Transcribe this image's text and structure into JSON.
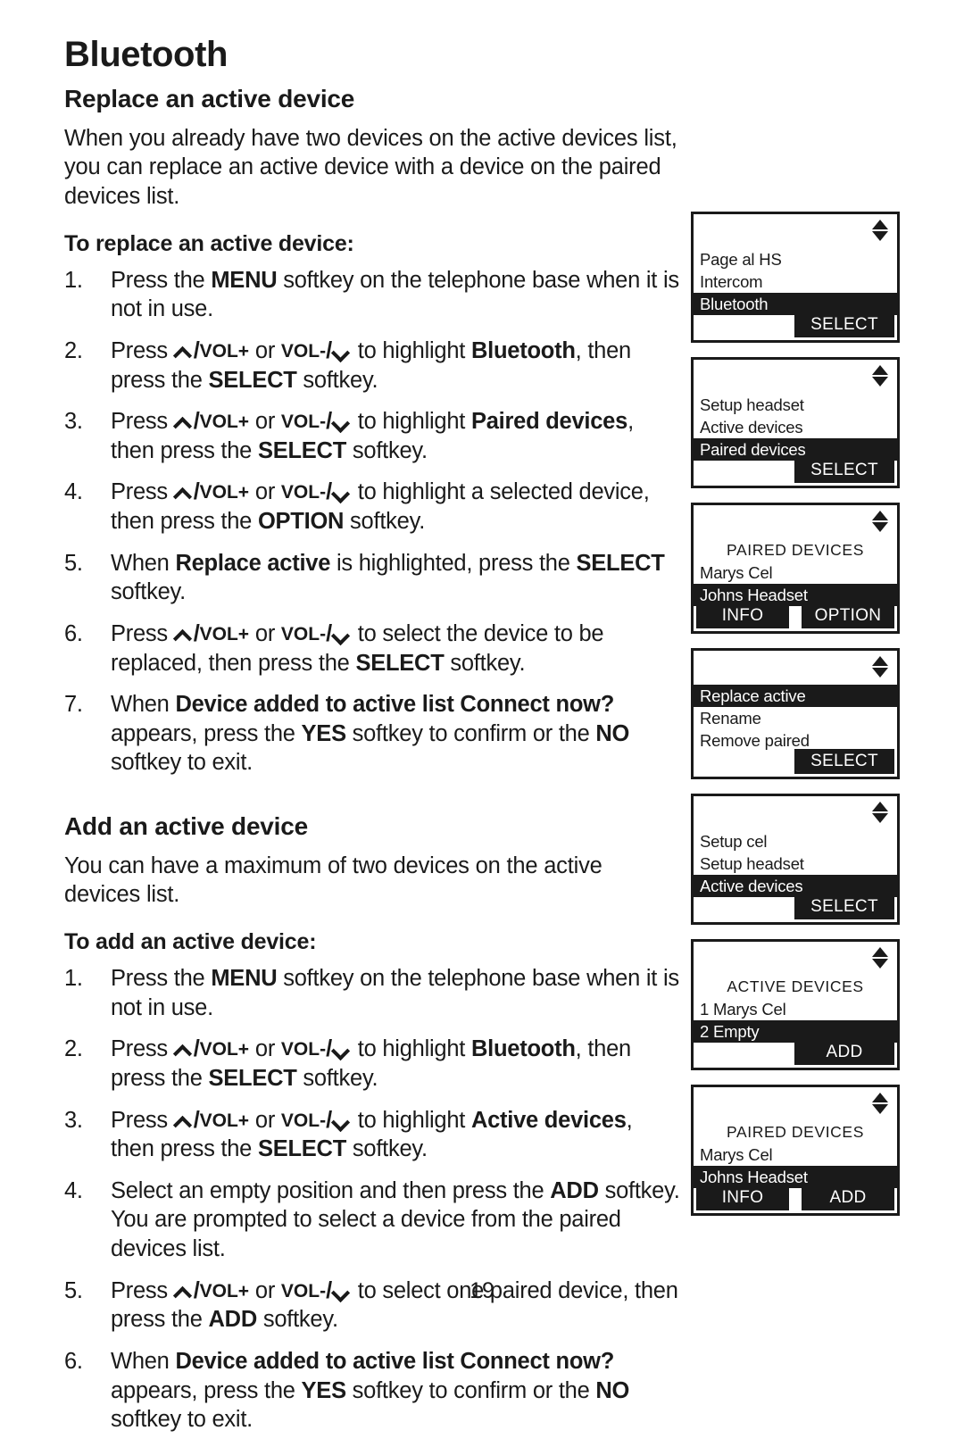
{
  "document": {
    "chapter_title": "Bluetooth",
    "page_number": "19"
  },
  "section_replace": {
    "heading": "Replace an active device",
    "intro": "When you already have two devices on the active devices list, you can replace an active device with a device on the paired devices list.",
    "subhead": "To replace an active device:",
    "steps": [
      {
        "num": "1.",
        "parts": [
          {
            "t": "Press the ",
            "b": false
          },
          {
            "t": "MENU",
            "b": true
          },
          {
            "t": " softkey on the telephone base when it is not in use.",
            "b": false
          }
        ]
      },
      {
        "num": "2.",
        "parts": [
          {
            "t": "Press ",
            "b": false
          },
          {
            "t": "VOLUP",
            "b": false,
            "icon": "vol-up-key"
          },
          {
            "t": " or ",
            "b": false
          },
          {
            "t": "VOLDOWN",
            "b": false,
            "icon": "vol-down-key"
          },
          {
            "t": " to highlight ",
            "b": false
          },
          {
            "t": "Bluetooth",
            "b": true
          },
          {
            "t": ", then press the ",
            "b": false
          },
          {
            "t": "SELECT",
            "b": true
          },
          {
            "t": " softkey.",
            "b": false
          }
        ]
      },
      {
        "num": "3.",
        "parts": [
          {
            "t": "Press ",
            "b": false
          },
          {
            "t": "VOLUP",
            "b": false,
            "icon": "vol-up-key"
          },
          {
            "t": " or ",
            "b": false
          },
          {
            "t": "VOLDOWN",
            "b": false,
            "icon": "vol-down-key"
          },
          {
            "t": " to highlight ",
            "b": false
          },
          {
            "t": "Paired devices",
            "b": true
          },
          {
            "t": ", then press the ",
            "b": false
          },
          {
            "t": "SELECT",
            "b": true
          },
          {
            "t": " softkey.",
            "b": false
          }
        ]
      },
      {
        "num": "4.",
        "parts": [
          {
            "t": "Press ",
            "b": false
          },
          {
            "t": "VOLUP",
            "b": false,
            "icon": "vol-up-key"
          },
          {
            "t": " or ",
            "b": false
          },
          {
            "t": "VOLDOWN",
            "b": false,
            "icon": "vol-down-key"
          },
          {
            "t": " to highlight a selected device, then press the ",
            "b": false
          },
          {
            "t": "OPTION",
            "b": true
          },
          {
            "t": " softkey.",
            "b": false
          }
        ]
      },
      {
        "num": "5.",
        "parts": [
          {
            "t": "When ",
            "b": false
          },
          {
            "t": "Replace active",
            "b": true
          },
          {
            "t": " is highlighted, press the ",
            "b": false
          },
          {
            "t": "SELECT",
            "b": true
          },
          {
            "t": " softkey.",
            "b": false
          }
        ]
      },
      {
        "num": "6.",
        "parts": [
          {
            "t": "Press ",
            "b": false
          },
          {
            "t": "VOLUP",
            "b": false,
            "icon": "vol-up-key"
          },
          {
            "t": " or ",
            "b": false
          },
          {
            "t": "VOLDOWN",
            "b": false,
            "icon": "vol-down-key"
          },
          {
            "t": " to select the device to be replaced, then press the ",
            "b": false
          },
          {
            "t": "SELECT",
            "b": true
          },
          {
            "t": " softkey.",
            "b": false
          }
        ]
      },
      {
        "num": "7.",
        "parts": [
          {
            "t": "When ",
            "b": false
          },
          {
            "t": "Device added to active list Connect now?",
            "b": true
          },
          {
            "t": " appears, press the ",
            "b": false
          },
          {
            "t": "YES",
            "b": true
          },
          {
            "t": " softkey to confirm or the ",
            "b": false
          },
          {
            "t": "NO",
            "b": true
          },
          {
            "t": " softkey to exit.",
            "b": false
          }
        ]
      }
    ]
  },
  "section_add": {
    "heading": "Add an active device",
    "intro": "You can have a maximum of two devices on the active devices list.",
    "subhead": "To add an active device:",
    "steps": [
      {
        "num": "1.",
        "parts": [
          {
            "t": "Press the ",
            "b": false
          },
          {
            "t": "MENU",
            "b": true
          },
          {
            "t": " softkey on the telephone base when it is not in use.",
            "b": false
          }
        ]
      },
      {
        "num": "2.",
        "parts": [
          {
            "t": "Press ",
            "b": false
          },
          {
            "t": "VOLUP",
            "b": false,
            "icon": "vol-up-key"
          },
          {
            "t": " or ",
            "b": false
          },
          {
            "t": "VOLDOWN",
            "b": false,
            "icon": "vol-down-key"
          },
          {
            "t": " to highlight ",
            "b": false
          },
          {
            "t": "Bluetooth",
            "b": true
          },
          {
            "t": ", then press the ",
            "b": false
          },
          {
            "t": "SELECT",
            "b": true
          },
          {
            "t": " softkey.",
            "b": false
          }
        ]
      },
      {
        "num": "3.",
        "parts": [
          {
            "t": "Press ",
            "b": false
          },
          {
            "t": "VOLUP",
            "b": false,
            "icon": "vol-up-key"
          },
          {
            "t": " or ",
            "b": false
          },
          {
            "t": "VOLDOWN",
            "b": false,
            "icon": "vol-down-key"
          },
          {
            "t": " to highlight ",
            "b": false
          },
          {
            "t": "Active devices",
            "b": true
          },
          {
            "t": ", then press the ",
            "b": false
          },
          {
            "t": "SELECT",
            "b": true
          },
          {
            "t": " softkey.",
            "b": false
          }
        ]
      },
      {
        "num": "4.",
        "parts": [
          {
            "t": "Select an empty position and then press the ",
            "b": false
          },
          {
            "t": "ADD",
            "b": true
          },
          {
            "t": " softkey. You are prompted to select a device from the paired devices list.",
            "b": false
          }
        ]
      },
      {
        "num": "5.",
        "parts": [
          {
            "t": "Press ",
            "b": false
          },
          {
            "t": "VOLUP",
            "b": false,
            "icon": "vol-up-key"
          },
          {
            "t": " or ",
            "b": false
          },
          {
            "t": "VOLDOWN",
            "b": false,
            "icon": "vol-down-key"
          },
          {
            "t": " to select one paired device, then press the ",
            "b": false
          },
          {
            "t": "ADD",
            "b": true
          },
          {
            "t": " softkey.",
            "b": false
          }
        ]
      },
      {
        "num": "6.",
        "parts": [
          {
            "t": "When ",
            "b": false
          },
          {
            "t": "Device added to active list Connect now?",
            "b": true
          },
          {
            "t": " appears, press the ",
            "b": false
          },
          {
            "t": "YES",
            "b": true
          },
          {
            "t": " softkey to confirm or the ",
            "b": false
          },
          {
            "t": "NO",
            "b": true
          },
          {
            "t": " softkey to exit.",
            "b": false
          }
        ]
      }
    ]
  },
  "screens": [
    {
      "id": "menu-bluetooth",
      "rows": [
        {
          "text": "Page al HS",
          "highlighted": false,
          "title": false
        },
        {
          "text": "Intercom",
          "highlighted": false,
          "title": false
        },
        {
          "text": "Bluetooth",
          "highlighted": true,
          "title": false
        }
      ],
      "softkeys": [
        "SELECT"
      ]
    },
    {
      "id": "bluetooth-paired-devices",
      "rows": [
        {
          "text": "Setup headset",
          "highlighted": false,
          "title": false
        },
        {
          "text": "Active devices",
          "highlighted": false,
          "title": false
        },
        {
          "text": "Paired devices",
          "highlighted": true,
          "title": false
        }
      ],
      "softkeys": [
        "SELECT"
      ]
    },
    {
      "id": "paired-devices-option",
      "rows": [
        {
          "text": "PAIRED DEVICES",
          "highlighted": false,
          "title": true
        },
        {
          "text": "Marys Cel",
          "highlighted": false,
          "title": false
        },
        {
          "text": "Johns Headset",
          "highlighted": true,
          "title": false
        }
      ],
      "softkeys": [
        "INFO",
        "OPTION"
      ]
    },
    {
      "id": "option-replace-active",
      "rows": [
        {
          "text": "Replace active",
          "highlighted": true,
          "title": false
        },
        {
          "text": "Rename",
          "highlighted": false,
          "title": false
        },
        {
          "text": "Remove paired",
          "highlighted": false,
          "title": false
        }
      ],
      "softkeys": [
        "SELECT"
      ]
    },
    {
      "id": "bluetooth-active-devices",
      "rows": [
        {
          "text": "Setup cel",
          "highlighted": false,
          "title": false
        },
        {
          "text": "Setup headset",
          "highlighted": false,
          "title": false
        },
        {
          "text": "Active devices",
          "highlighted": true,
          "title": false
        }
      ],
      "softkeys": [
        "SELECT"
      ]
    },
    {
      "id": "active-devices-list",
      "rows": [
        {
          "text": "ACTIVE DEVICES",
          "highlighted": false,
          "title": true
        },
        {
          "text": "1 Marys Cel",
          "highlighted": false,
          "title": false
        },
        {
          "text": "2 Empty",
          "highlighted": true,
          "title": false
        }
      ],
      "softkeys": [
        "ADD"
      ]
    },
    {
      "id": "paired-devices-add",
      "rows": [
        {
          "text": "PAIRED DEVICES",
          "highlighted": false,
          "title": true
        },
        {
          "text": "Marys Cel",
          "highlighted": false,
          "title": false
        },
        {
          "text": "Johns Headset",
          "highlighted": true,
          "title": false
        }
      ],
      "softkeys": [
        "INFO",
        "ADD"
      ]
    }
  ],
  "icons": {
    "vol_up_label": "VOL+",
    "vol_down_label": "VOL-",
    "scroll_up": "scroll-up-arrow",
    "scroll_down": "scroll-down-arrow"
  }
}
